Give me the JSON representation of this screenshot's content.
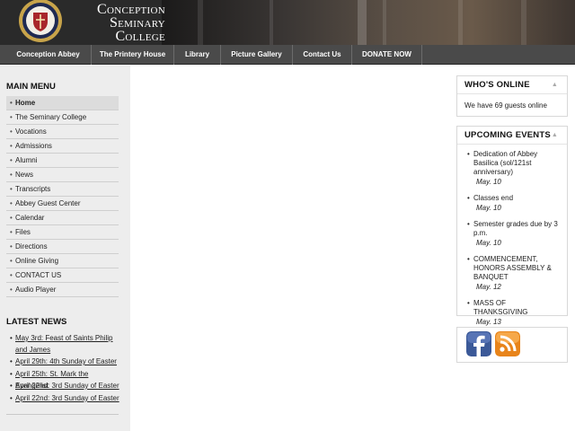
{
  "site": {
    "title_lines": [
      "Conception",
      "Seminary",
      "College"
    ]
  },
  "colors": {
    "nav_bg": "#4a4a4a",
    "sidebar_bg": "#ededed",
    "facebook": "#3b5998",
    "rss": "#f29418"
  },
  "nav": {
    "items": [
      "Conception Abbey",
      "The Printery House",
      "Library",
      "Picture Gallery",
      "Contact Us",
      "DONATE NOW"
    ]
  },
  "main_menu": {
    "heading": "MAIN MENU",
    "items": [
      "Home",
      "The Seminary College",
      "Vocations",
      "Admissions",
      "Alumni",
      "News",
      "Transcripts",
      "Abbey Guest Center",
      "Calendar",
      "Files",
      "Directions",
      "Online Giving",
      "CONTACT US",
      "Audio Player"
    ],
    "active": "Home"
  },
  "latest_news": {
    "heading": "LATEST NEWS",
    "items": [
      "May 3rd: Feast of Saints Philip and James",
      "April 29th: 4th Sunday of Easter",
      "April 25th: St. Mark the Evangelist",
      "April 22nd: 3rd Sunday of Easter",
      "April 22nd: 3rd Sunday of Easter"
    ]
  },
  "whos_online": {
    "heading": "WHO'S ONLINE",
    "text": "We have 69 guests online"
  },
  "upcoming_events": {
    "heading": "UPCOMING EVENTS",
    "items": [
      {
        "title": "Dedication of Abbey Basilica (sol/121st anniversary)",
        "date": "May. 10"
      },
      {
        "title": "Classes end",
        "date": "May. 10"
      },
      {
        "title": "Semester grades due by 3 p.m.",
        "date": "May. 10"
      },
      {
        "title": "COMMENCEMENT, HONORS ASSEMBLY & BANQUET",
        "date": "May. 12"
      },
      {
        "title": "MASS OF THANKSGIVING",
        "date": "May. 13"
      }
    ]
  },
  "social": {
    "icons": [
      "facebook-icon",
      "rss-icon"
    ]
  }
}
